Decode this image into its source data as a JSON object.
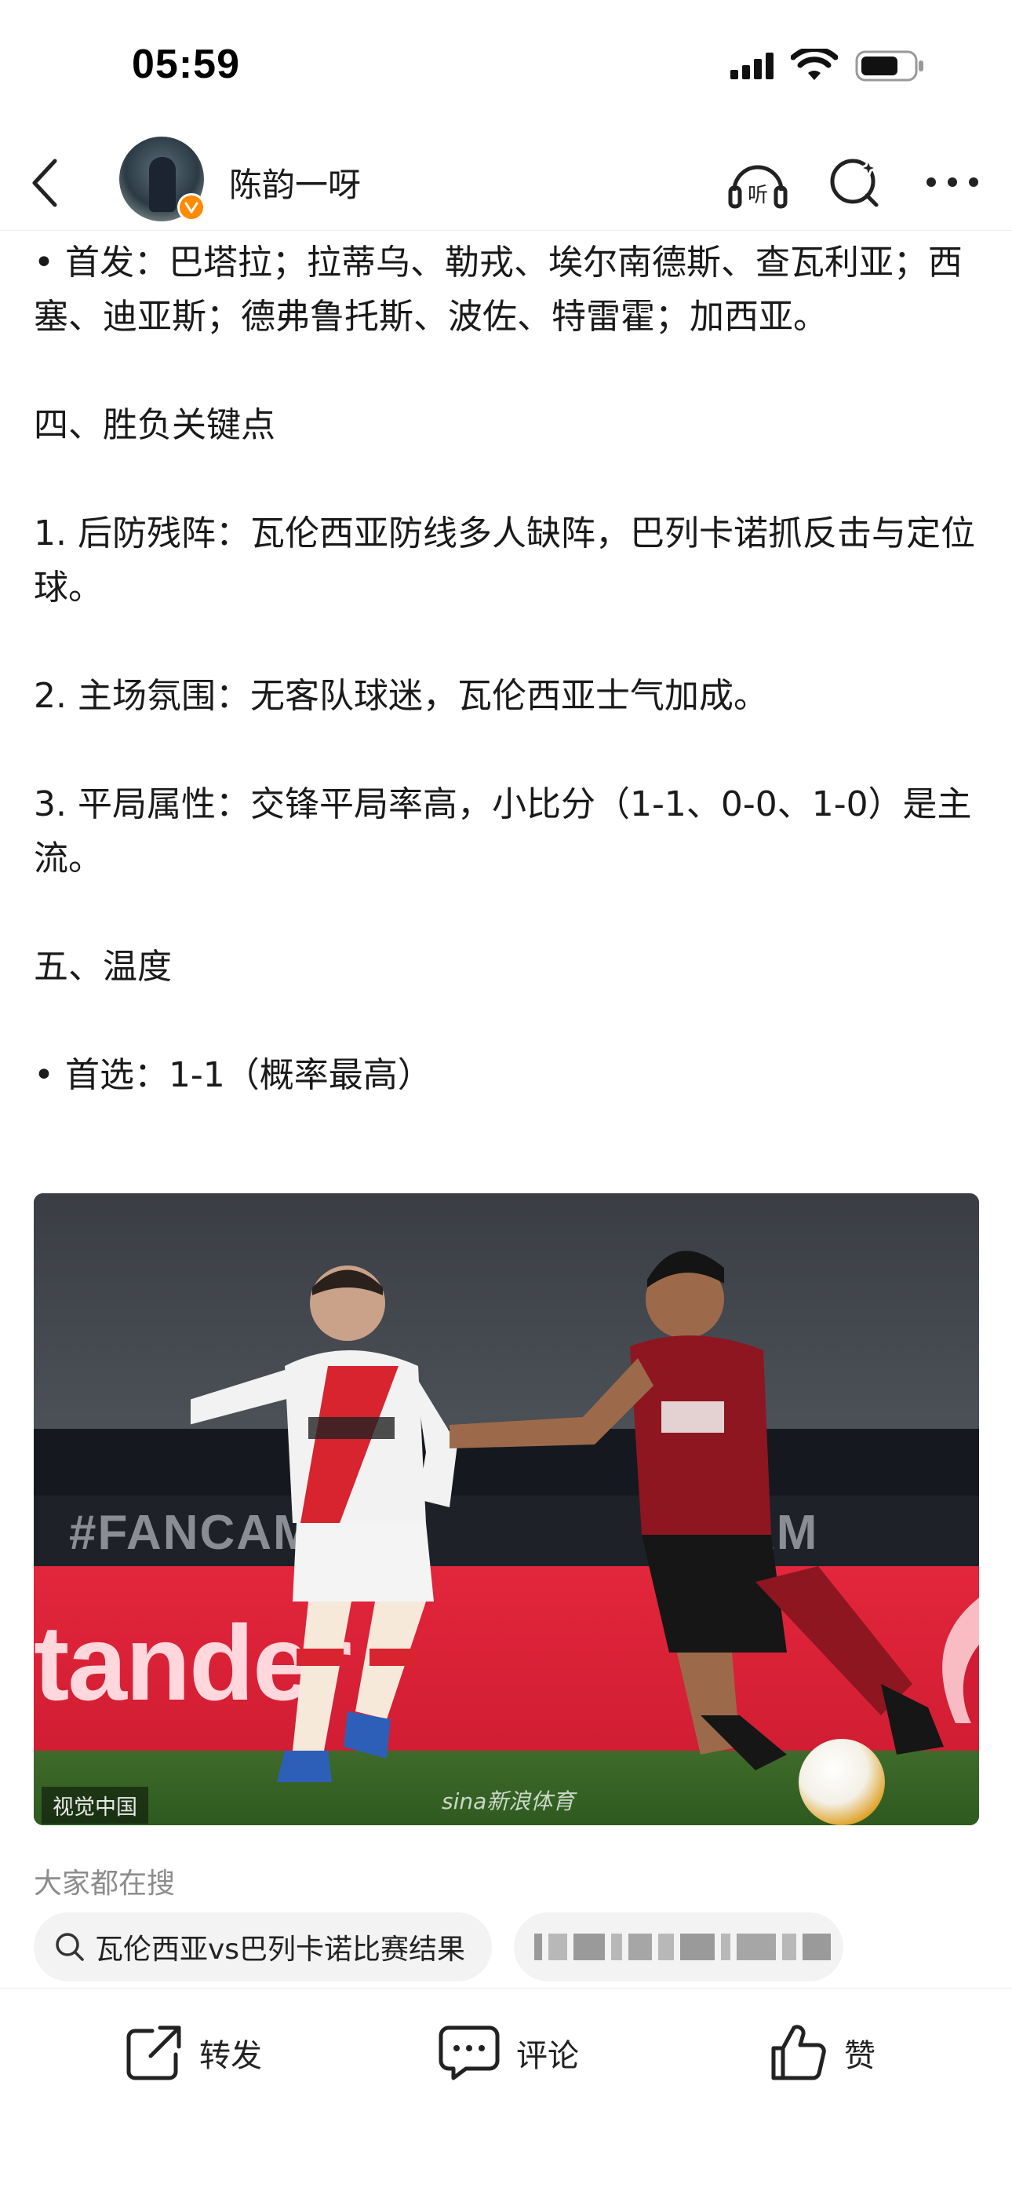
{
  "status_bar": {
    "time": "05:59"
  },
  "header": {
    "user_name": "陈韵一呀",
    "listen_label": "听"
  },
  "article": {
    "paragraphs": [
      "• 首发：巴塔拉；拉蒂乌、勒戎、埃尔南德斯、查瓦利亚；西塞、迪亚斯；德弗鲁托斯、波佐、特雷霍；加西亚。",
      "四、胜负关键点",
      "1. 后防残阵：瓦伦西亚防线多人缺阵，巴列卡诺抓反击与定位球。",
      "2. 主场氛围：无客队球迷，瓦伦西亚士气加成。",
      "3. 平局属性：交锋平局率高，小比分（1-1、0-0、1-0）是主流。",
      "五、温度",
      "• 首选：1-1（概率最高）"
    ]
  },
  "photo": {
    "board_text": "#FANCAM",
    "board_text_2": "AM",
    "sponsor_text": "tander",
    "credit": "视觉中国",
    "watermark": "sina新浪体育"
  },
  "searching": {
    "title": "大家都在搜",
    "chips": [
      "瓦伦西亚vs巴列卡诺比赛结果"
    ]
  },
  "bottom_bar": {
    "share_label": "转发",
    "comment_label": "评论",
    "like_label": "赞"
  }
}
